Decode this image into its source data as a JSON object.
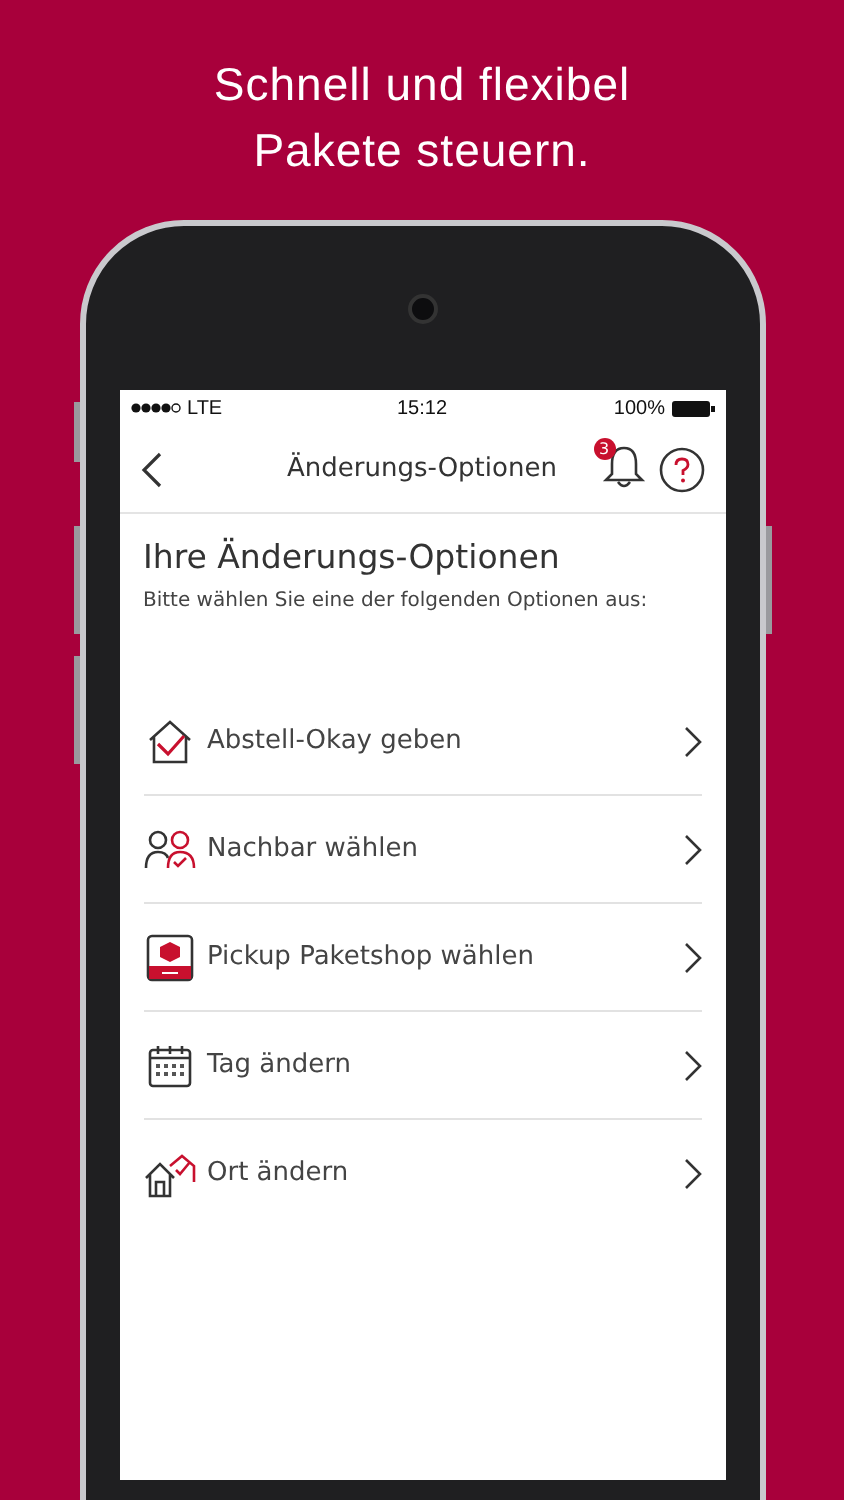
{
  "headline": [
    "Schnell und flexibel",
    "Pakete steuern."
  ],
  "status_bar": {
    "carrier": "LTE",
    "time": "15:12",
    "battery": "100%"
  },
  "nav": {
    "title": "Änderungs-Optionen",
    "notification_count": "3"
  },
  "heading": "Ihre Änderungs-Optionen",
  "subtitle": "Bitte wählen Sie eine der folgenden Optionen aus:",
  "options": [
    {
      "kind": "house-check",
      "label": "Abstell-Okay geben"
    },
    {
      "kind": "people",
      "label": "Nachbar wählen"
    },
    {
      "kind": "shop",
      "label": "Pickup Paketshop wählen"
    },
    {
      "kind": "calendar",
      "label": "Tag ändern"
    },
    {
      "kind": "houses",
      "label": "Ort ändern"
    }
  ]
}
